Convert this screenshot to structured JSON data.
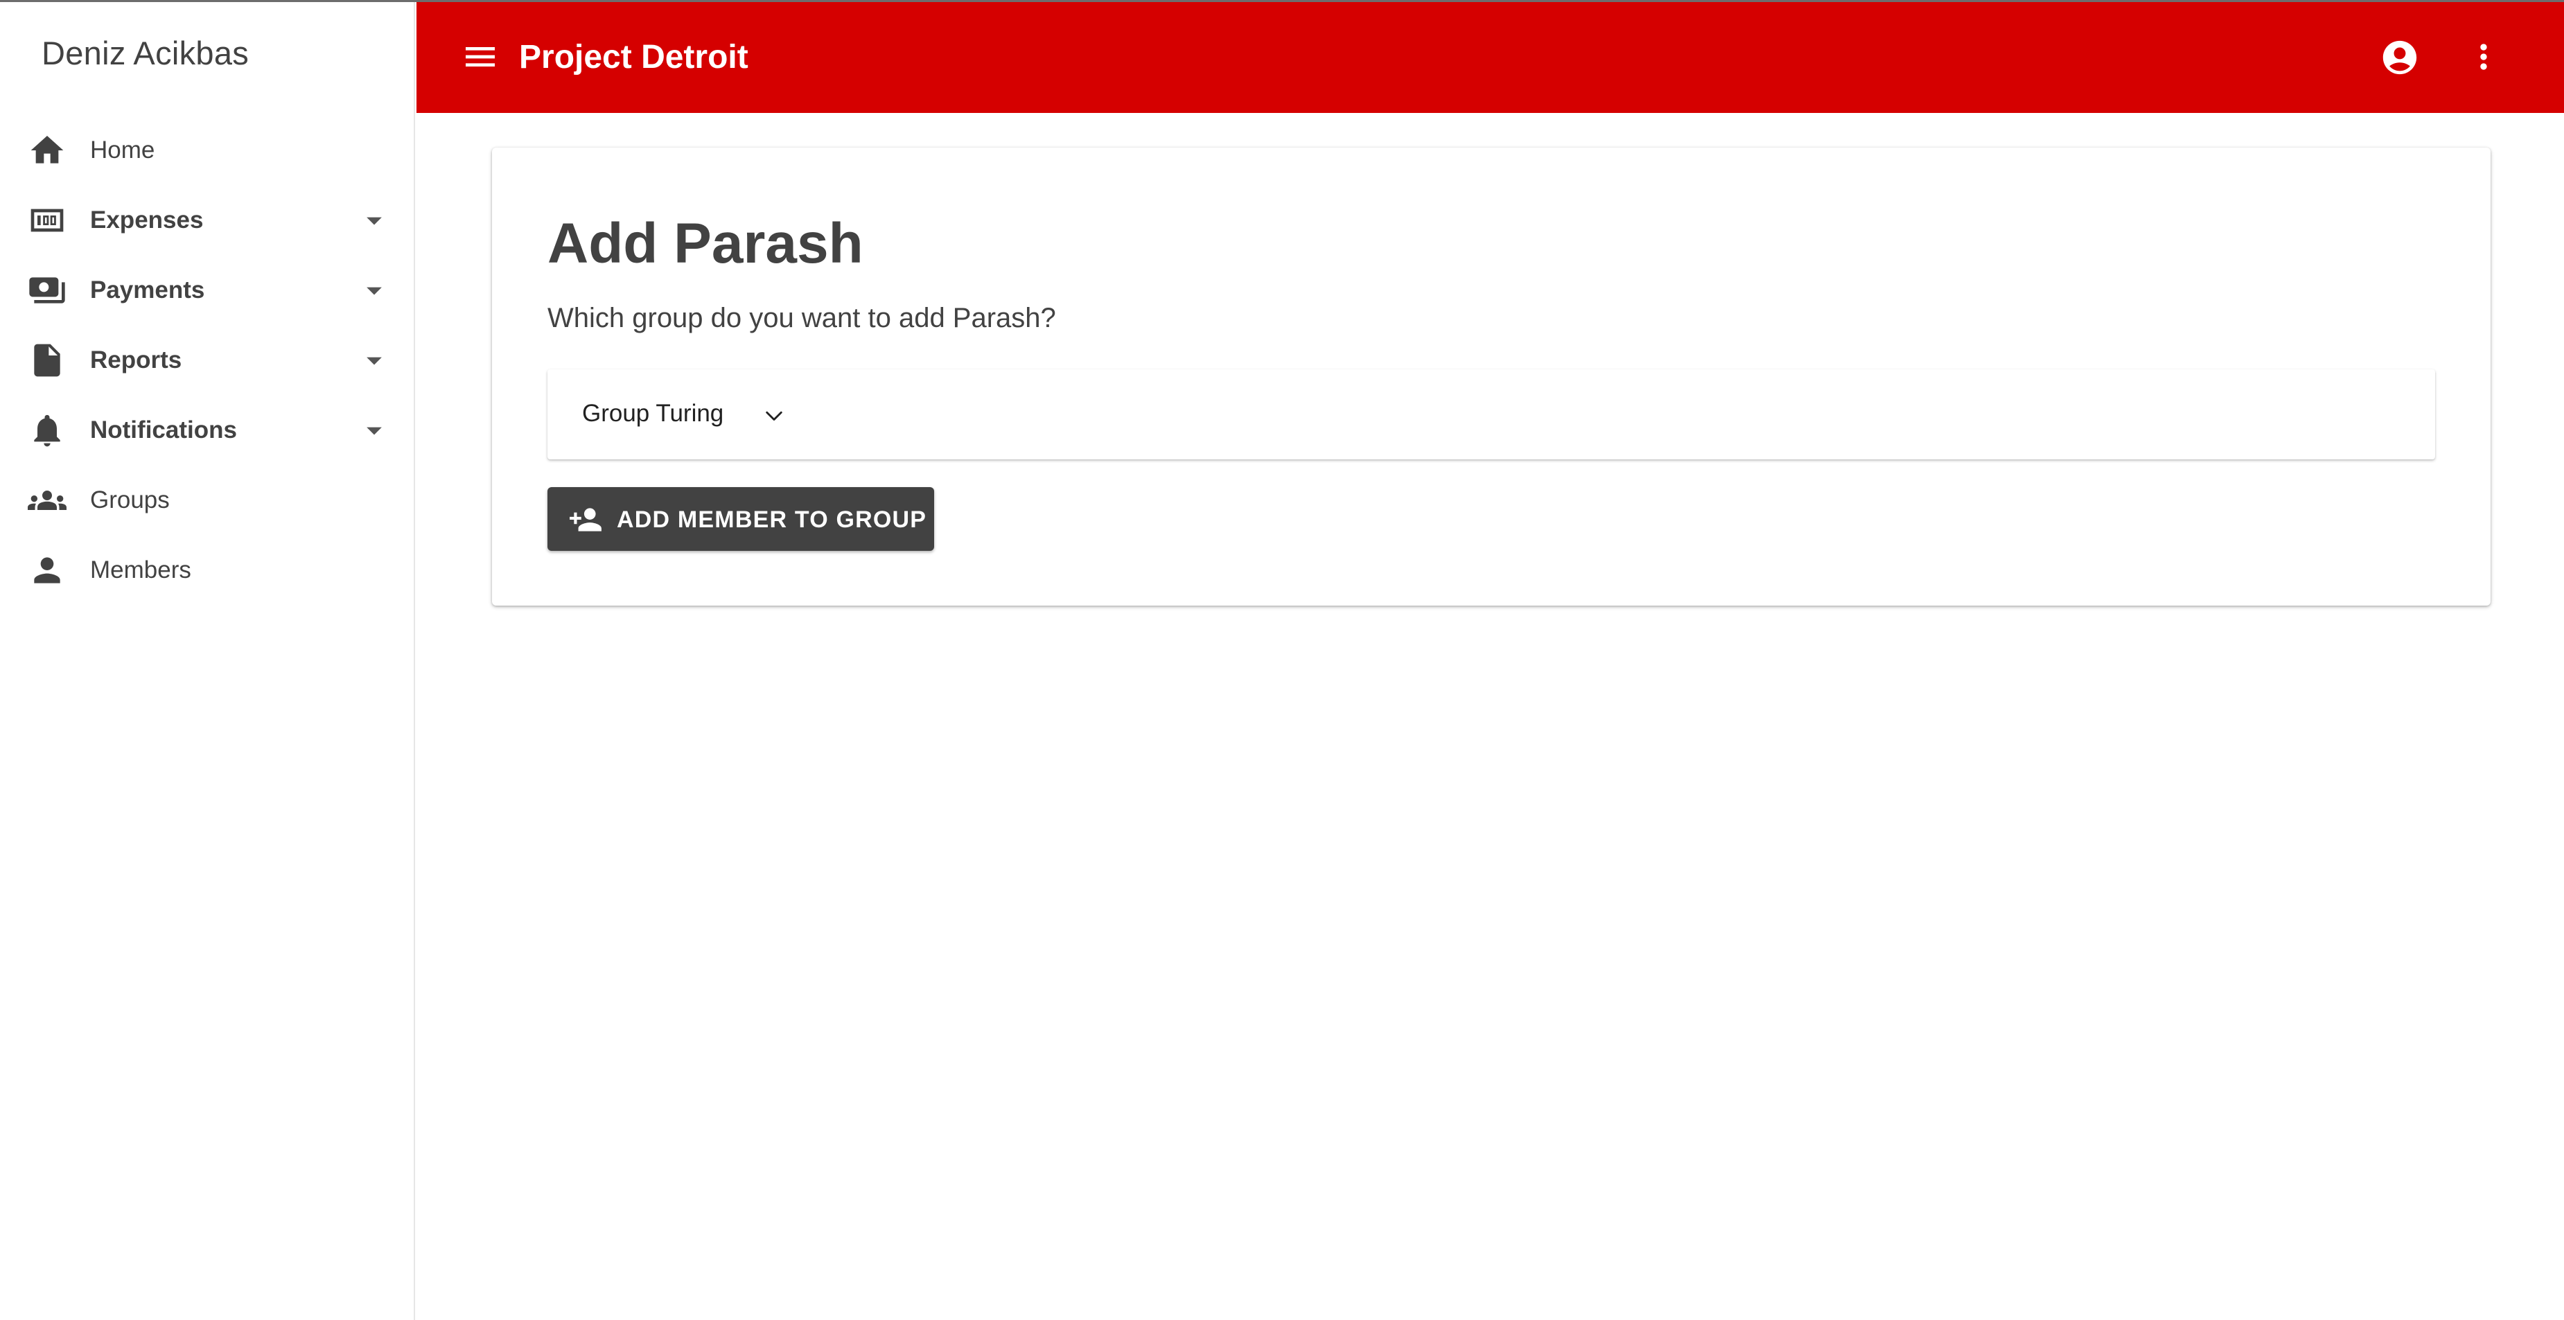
{
  "user": {
    "name": "Deniz Acikbas"
  },
  "app": {
    "title": "Project Detroit",
    "accent_color": "#d50000"
  },
  "sidebar": {
    "items": [
      {
        "label": "Home",
        "icon": "home-icon",
        "expandable": false
      },
      {
        "label": "Expenses",
        "icon": "expenses-icon",
        "expandable": true
      },
      {
        "label": "Payments",
        "icon": "payments-icon",
        "expandable": true
      },
      {
        "label": "Reports",
        "icon": "reports-icon",
        "expandable": true
      },
      {
        "label": "Notifications",
        "icon": "bell-icon",
        "expandable": true
      },
      {
        "label": "Groups",
        "icon": "groups-icon",
        "expandable": false
      },
      {
        "label": "Members",
        "icon": "person-icon",
        "expandable": false
      }
    ]
  },
  "header": {
    "menu_icon": "menu-icon",
    "account_icon": "account-circle-icon",
    "more_icon": "more-vert-icon"
  },
  "main": {
    "title": "Add Parash",
    "subtitle": "Which group do you want to add Parash?",
    "group_select": {
      "selected": "Group Turing",
      "icon": "chevron-down-icon"
    },
    "add_button": {
      "label": "ADD MEMBER TO GROUP",
      "icon": "person-add-icon"
    }
  }
}
